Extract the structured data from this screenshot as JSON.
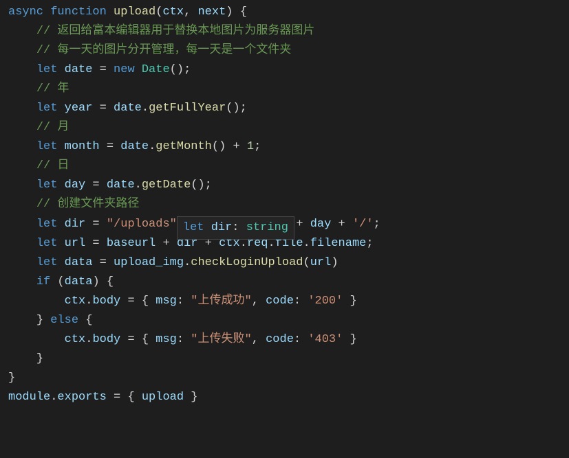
{
  "tooltip": {
    "kw": "let",
    "var": "dir",
    "colon": ": ",
    "type": "string"
  },
  "lines": [
    {
      "indent": 0,
      "tokens": [
        {
          "t": "kw",
          "v": "async"
        },
        {
          "t": "pun",
          "v": " "
        },
        {
          "t": "kw",
          "v": "function"
        },
        {
          "t": "pun",
          "v": " "
        },
        {
          "t": "fn",
          "v": "upload"
        },
        {
          "t": "pun",
          "v": "("
        },
        {
          "t": "var",
          "v": "ctx"
        },
        {
          "t": "pun",
          "v": ", "
        },
        {
          "t": "var",
          "v": "next"
        },
        {
          "t": "pun",
          "v": ") {"
        }
      ]
    },
    {
      "indent": 1,
      "tokens": [
        {
          "t": "cmt",
          "v": "// 返回给富本编辑器用于替换本地图片为服务器图片"
        }
      ]
    },
    {
      "indent": 1,
      "tokens": [
        {
          "t": "cmt",
          "v": "// 每一天的图片分开管理，每一天是一个文件夹"
        }
      ]
    },
    {
      "indent": 1,
      "tokens": [
        {
          "t": "kw",
          "v": "let"
        },
        {
          "t": "pun",
          "v": " "
        },
        {
          "t": "var",
          "v": "date"
        },
        {
          "t": "pun",
          "v": " = "
        },
        {
          "t": "kw",
          "v": "new"
        },
        {
          "t": "pun",
          "v": " "
        },
        {
          "t": "cls",
          "v": "Date"
        },
        {
          "t": "pun",
          "v": "();"
        }
      ]
    },
    {
      "indent": 1,
      "tokens": [
        {
          "t": "cmt",
          "v": "// 年"
        }
      ]
    },
    {
      "indent": 1,
      "tokens": [
        {
          "t": "kw",
          "v": "let"
        },
        {
          "t": "pun",
          "v": " "
        },
        {
          "t": "var",
          "v": "year"
        },
        {
          "t": "pun",
          "v": " = "
        },
        {
          "t": "var",
          "v": "date"
        },
        {
          "t": "pun",
          "v": "."
        },
        {
          "t": "fn",
          "v": "getFullYear"
        },
        {
          "t": "pun",
          "v": "();"
        }
      ]
    },
    {
      "indent": 1,
      "tokens": [
        {
          "t": "cmt",
          "v": "// 月"
        }
      ]
    },
    {
      "indent": 1,
      "tokens": [
        {
          "t": "kw",
          "v": "let"
        },
        {
          "t": "pun",
          "v": " "
        },
        {
          "t": "var",
          "v": "month"
        },
        {
          "t": "pun",
          "v": " = "
        },
        {
          "t": "var",
          "v": "date"
        },
        {
          "t": "pun",
          "v": "."
        },
        {
          "t": "fn",
          "v": "getMonth"
        },
        {
          "t": "pun",
          "v": "() + "
        },
        {
          "t": "num",
          "v": "1"
        },
        {
          "t": "pun",
          "v": ";"
        }
      ]
    },
    {
      "indent": 1,
      "tokens": [
        {
          "t": "cmt",
          "v": "// 日"
        }
      ]
    },
    {
      "indent": 1,
      "tokens": [
        {
          "t": "kw",
          "v": "let"
        },
        {
          "t": "pun",
          "v": " "
        },
        {
          "t": "var",
          "v": "day"
        },
        {
          "t": "pun",
          "v": " = "
        },
        {
          "t": "var",
          "v": "date"
        },
        {
          "t": "pun",
          "v": "."
        },
        {
          "t": "fn",
          "v": "getDate"
        },
        {
          "t": "pun",
          "v": "();"
        }
      ]
    },
    {
      "indent": 1,
      "tokens": [
        {
          "t": "cmt",
          "v": "// 创建文件夹路径"
        }
      ]
    },
    {
      "indent": 1,
      "tokens": [
        {
          "t": "kw",
          "v": "let"
        },
        {
          "t": "pun",
          "v": " "
        },
        {
          "t": "var",
          "v": "dir"
        },
        {
          "t": "pun",
          "v": " = "
        },
        {
          "t": "str",
          "v": "\"/uploads\""
        },
        {
          "t": "tooltip",
          "v": ""
        },
        {
          "t": "pun",
          "v": "+ "
        },
        {
          "t": "var",
          "v": "day"
        },
        {
          "t": "pun",
          "v": " + "
        },
        {
          "t": "str",
          "v": "'/'"
        },
        {
          "t": "pun",
          "v": ";"
        }
      ]
    },
    {
      "indent": 1,
      "tokens": [
        {
          "t": "kw",
          "v": "let"
        },
        {
          "t": "pun",
          "v": " "
        },
        {
          "t": "var",
          "v": "url"
        },
        {
          "t": "pun",
          "v": " = "
        },
        {
          "t": "var",
          "v": "baseurl"
        },
        {
          "t": "pun",
          "v": " + "
        },
        {
          "t": "var",
          "v": "dir"
        },
        {
          "t": "pun",
          "v": " + "
        },
        {
          "t": "var",
          "v": "ctx"
        },
        {
          "t": "pun",
          "v": "."
        },
        {
          "t": "var",
          "v": "req"
        },
        {
          "t": "pun",
          "v": "."
        },
        {
          "t": "var",
          "v": "file"
        },
        {
          "t": "pun",
          "v": "."
        },
        {
          "t": "var",
          "v": "filename"
        },
        {
          "t": "pun",
          "v": ";"
        }
      ]
    },
    {
      "indent": 1,
      "tokens": [
        {
          "t": "kw",
          "v": "let"
        },
        {
          "t": "pun",
          "v": " "
        },
        {
          "t": "var",
          "v": "data"
        },
        {
          "t": "pun",
          "v": " = "
        },
        {
          "t": "var",
          "v": "upload_img"
        },
        {
          "t": "pun",
          "v": "."
        },
        {
          "t": "fn",
          "v": "checkLoginUpload"
        },
        {
          "t": "pun",
          "v": "("
        },
        {
          "t": "var",
          "v": "url"
        },
        {
          "t": "pun",
          "v": ")"
        }
      ]
    },
    {
      "indent": 1,
      "tokens": [
        {
          "t": "kw",
          "v": "if"
        },
        {
          "t": "pun",
          "v": " ("
        },
        {
          "t": "var",
          "v": "data"
        },
        {
          "t": "pun",
          "v": ") {"
        }
      ]
    },
    {
      "indent": 2,
      "tokens": [
        {
          "t": "var",
          "v": "ctx"
        },
        {
          "t": "pun",
          "v": "."
        },
        {
          "t": "var",
          "v": "body"
        },
        {
          "t": "pun",
          "v": " = { "
        },
        {
          "t": "var",
          "v": "msg"
        },
        {
          "t": "pun",
          "v": ": "
        },
        {
          "t": "str",
          "v": "\"上传成功\""
        },
        {
          "t": "pun",
          "v": ", "
        },
        {
          "t": "var",
          "v": "code"
        },
        {
          "t": "pun",
          "v": ": "
        },
        {
          "t": "str",
          "v": "'200'"
        },
        {
          "t": "pun",
          "v": " }"
        }
      ]
    },
    {
      "indent": 1,
      "tokens": [
        {
          "t": "pun",
          "v": "} "
        },
        {
          "t": "kw",
          "v": "else"
        },
        {
          "t": "pun",
          "v": " {"
        }
      ]
    },
    {
      "indent": 2,
      "tokens": [
        {
          "t": "var",
          "v": "ctx"
        },
        {
          "t": "pun",
          "v": "."
        },
        {
          "t": "var",
          "v": "body"
        },
        {
          "t": "pun",
          "v": " = { "
        },
        {
          "t": "var",
          "v": "msg"
        },
        {
          "t": "pun",
          "v": ": "
        },
        {
          "t": "str",
          "v": "\"上传失败\""
        },
        {
          "t": "pun",
          "v": ", "
        },
        {
          "t": "var",
          "v": "code"
        },
        {
          "t": "pun",
          "v": ": "
        },
        {
          "t": "str",
          "v": "'403'"
        },
        {
          "t": "pun",
          "v": " }"
        }
      ]
    },
    {
      "indent": 1,
      "tokens": [
        {
          "t": "pun",
          "v": "}"
        }
      ]
    },
    {
      "indent": 0,
      "tokens": [
        {
          "t": "pun",
          "v": "}"
        }
      ]
    },
    {
      "indent": 0,
      "tokens": [
        {
          "t": "var",
          "v": "module"
        },
        {
          "t": "pun",
          "v": "."
        },
        {
          "t": "var",
          "v": "exports"
        },
        {
          "t": "pun",
          "v": " = { "
        },
        {
          "t": "var",
          "v": "upload"
        },
        {
          "t": "pun",
          "v": " }"
        }
      ]
    }
  ]
}
